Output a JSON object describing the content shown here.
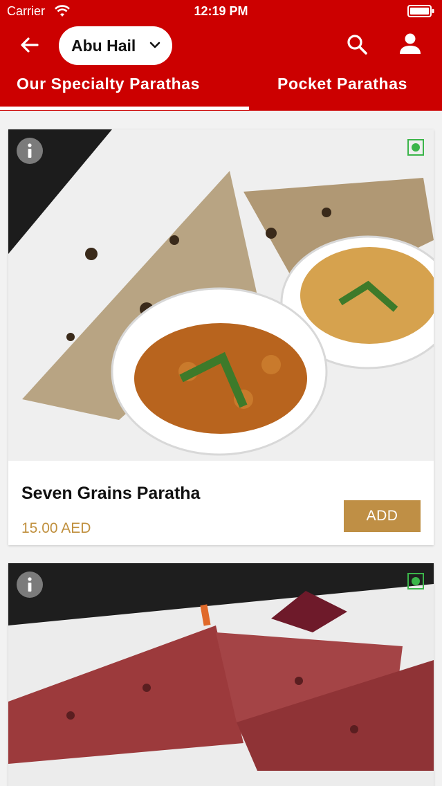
{
  "status_bar": {
    "carrier": "Carrier",
    "time": "12:19 PM"
  },
  "header": {
    "location": "Abu Hail"
  },
  "tabs": [
    {
      "label": "Our Specialty Parathas",
      "active": true
    },
    {
      "label": "Pocket Parathas",
      "active": false
    }
  ],
  "menu_items": [
    {
      "name": "Seven Grains Paratha",
      "price": "15.00 AED",
      "add_label": "ADD",
      "veg": true
    },
    {
      "name": "",
      "price": "",
      "add_label": "",
      "veg": true
    }
  ],
  "colors": {
    "brand_red": "#cc0000",
    "accent_gold": "#bf8f45",
    "veg_green": "#3bb54a"
  },
  "icons": [
    "wifi-icon",
    "battery-icon",
    "back-arrow-icon",
    "chevron-down-icon",
    "search-icon",
    "user-icon",
    "info-icon",
    "veg-indicator-icon"
  ]
}
